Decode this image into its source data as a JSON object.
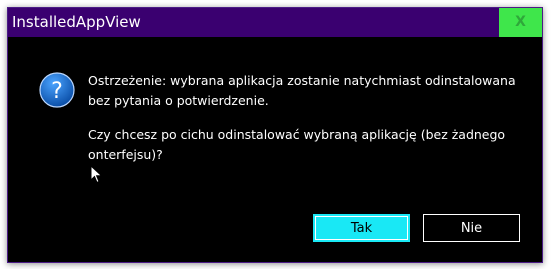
{
  "window": {
    "title": "InstalledAppView",
    "close_label": "X"
  },
  "dialog": {
    "icon": "question-icon",
    "message_line1": "Ostrzeżenie: wybrana aplikacja zostanie natychmiast odinstalowana bez pytania o potwierdzenie.",
    "message_line2": "Czy chcesz po cichu odinstalować wybraną aplikację (bez żadnego onterfejsu)?",
    "yes_label": "Tak",
    "no_label": "Nie"
  },
  "colors": {
    "titlebar": "#3a0070",
    "background": "#000000",
    "close_button": "#3fe64b",
    "primary_button": "#19e8f5",
    "icon_blue": "#1a6fd1"
  }
}
